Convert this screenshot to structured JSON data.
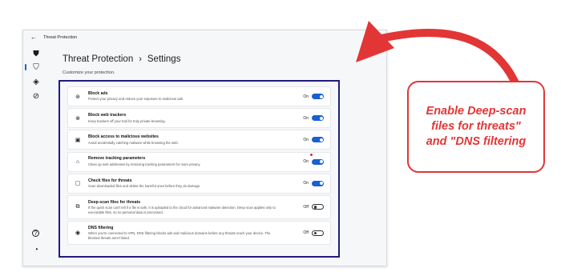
{
  "window": {
    "title": "Threat Protection",
    "back_glyph": "←"
  },
  "nav": [
    {
      "icon": "shield-icon",
      "glyph": "⛊"
    },
    {
      "icon": "shield-check-icon",
      "glyph": "⛉",
      "active": true
    },
    {
      "icon": "diamond-icon",
      "glyph": "◈"
    },
    {
      "icon": "compass-icon",
      "glyph": "⊘"
    },
    {
      "icon": "help-icon",
      "glyph": "?"
    },
    {
      "icon": "account-icon",
      "glyph": "◔"
    }
  ],
  "page": {
    "title_part1": "Threat Protection",
    "separator": "›",
    "title_part2": "Settings",
    "subtitle": "Customize your protection."
  },
  "settings": [
    {
      "icon": "ad-block-icon",
      "glyph": "⊛",
      "title": "Block ads",
      "desc": "Protect your privacy and reduce your exposure to malicious ads.",
      "state": "On",
      "on": true
    },
    {
      "icon": "tracker-block-icon",
      "glyph": "⊗",
      "title": "Block web trackers",
      "desc": "Keep trackers off your trail for truly private browsing.",
      "state": "On",
      "on": true
    },
    {
      "icon": "malicious-site-icon",
      "glyph": "▣",
      "title": "Block access to malicious websites",
      "desc": "Avoid accidentally catching malware while browsing the web.",
      "state": "On",
      "on": true
    },
    {
      "icon": "link-clean-icon",
      "glyph": "⌂",
      "title": "Remove tracking parameters",
      "desc": "Clean up web addresses by removing tracking parameters for more privacy.",
      "state": "On",
      "on": true
    },
    {
      "icon": "file-check-icon",
      "glyph": "▢",
      "title": "Check files for threats",
      "desc": "Scan downloaded files and delete the harmful ones before they do damage.",
      "state": "On",
      "on": true
    },
    {
      "icon": "deep-scan-icon",
      "glyph": "⧉",
      "title": "Deep-scan files for threats",
      "desc": "If the quick scan can't tell if a file is safe, it is uploaded to the cloud for advanced malware detection. Deep scan applies only to executable files, so no personal data is processed.",
      "state": "Off",
      "on": false
    },
    {
      "icon": "dns-filter-icon",
      "glyph": "◉",
      "title": "DNS filtering",
      "desc": "When you're connected to VPN, DNS filtering blocks ads and malicious domains before any threats reach your device. The blocked threats aren't listed.",
      "state": "Off",
      "on": false
    }
  ],
  "callout": {
    "line1": "Enable Deep-scan",
    "line2": "files for threats\"",
    "line3": "and \"DNS filtering"
  },
  "colors": {
    "accent": "#1b5fd1",
    "highlight_border": "#1f1b7d",
    "annotation_red": "#e23636"
  }
}
